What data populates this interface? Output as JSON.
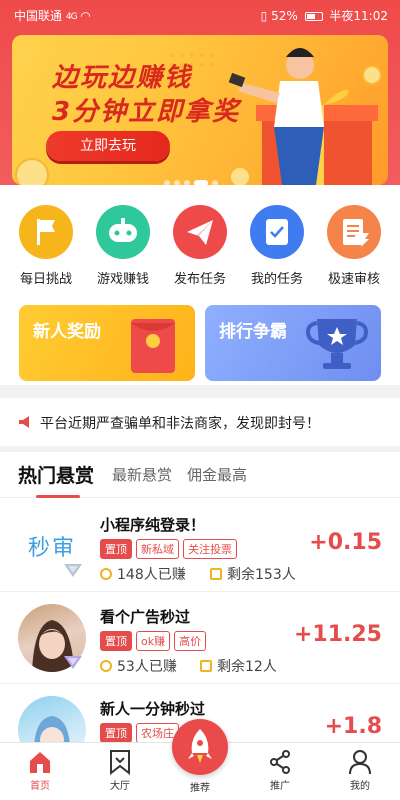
{
  "status_bar": {
    "carrier": "中国联通",
    "signal": "4G",
    "battery": "52%",
    "time": "半夜11:02"
  },
  "banner": {
    "title_line1": "边玩边赚钱",
    "title_line2": "3分钟立即拿奖",
    "button_label": "立即去玩"
  },
  "quick_actions": [
    {
      "label": "每日挑战",
      "icon": "flag-icon",
      "color": "#f7b51c"
    },
    {
      "label": "游戏赚钱",
      "icon": "gamepad-icon",
      "color": "#2ec89a"
    },
    {
      "label": "发布任务",
      "icon": "paper-plane-icon",
      "color": "#ef4a4a"
    },
    {
      "label": "我的任务",
      "icon": "task-check-icon",
      "color": "#3f7cf0"
    },
    {
      "label": "极速审核",
      "icon": "review-doc-icon",
      "color": "#f5844b"
    }
  ],
  "promos": [
    {
      "label": "新人奖励",
      "icon": "red-envelope-icon",
      "color": "#ffb81c"
    },
    {
      "label": "排行争霸",
      "icon": "trophy-icon",
      "color": "#7b9cf3"
    }
  ],
  "notice": {
    "text": "平台近期严查骗单和非法商家，发现即封号！",
    "icon": "megaphone-icon"
  },
  "tabs": [
    {
      "label": "热门悬赏",
      "active": true
    },
    {
      "label": "最新悬赏",
      "active": false
    },
    {
      "label": "佣金最高",
      "active": false
    }
  ],
  "tasks": [
    {
      "title": "小程序纯登录！",
      "avatar_text": "秒审",
      "tags": [
        "置顶",
        "新私域",
        "关注投票"
      ],
      "earned": "148人已赚",
      "remaining": "剩余153人",
      "reward": "+0.15"
    },
    {
      "title": "看个广告秒过",
      "avatar_text": "",
      "tags": [
        "置顶",
        "ok赚",
        "高价"
      ],
      "earned": "53人已赚",
      "remaining": "剩余12人",
      "reward": "+11.25"
    },
    {
      "title": "新人一分钟秒过",
      "avatar_text": "",
      "tags": [
        "置顶",
        "农场庄"
      ],
      "earned": "",
      "remaining": "",
      "reward": "+1.8"
    }
  ],
  "bottom_nav": [
    {
      "label": "首页",
      "icon": "home-icon",
      "active": true
    },
    {
      "label": "大厅",
      "icon": "bookmark-hall-icon",
      "active": false
    },
    {
      "label": "推荐",
      "icon": "rocket-icon",
      "active": false
    },
    {
      "label": "推广",
      "icon": "share-icon",
      "active": false
    },
    {
      "label": "我的",
      "icon": "user-icon",
      "active": false
    }
  ],
  "colors": {
    "brand_red": "#e54c4c",
    "header_red": "#ef4a4a",
    "banner_yellow": "#ffc740"
  }
}
